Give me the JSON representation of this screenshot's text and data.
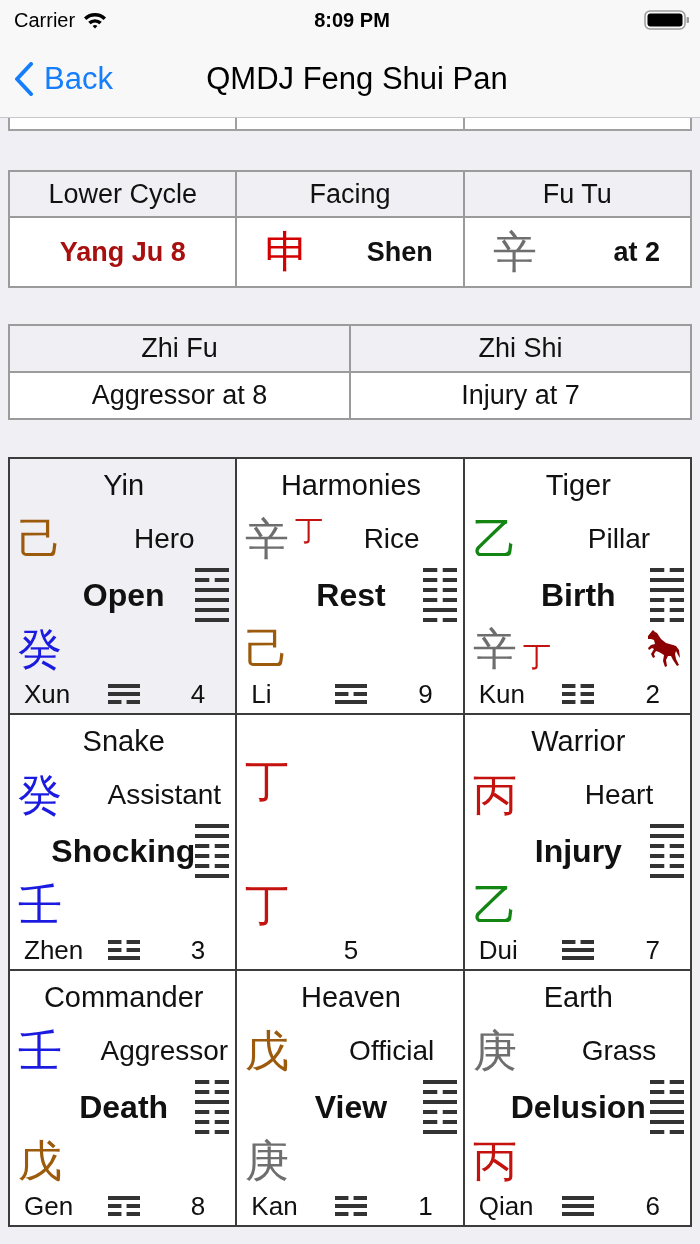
{
  "status_bar": {
    "carrier": "Carrier",
    "time": "8:09 PM"
  },
  "nav": {
    "back": "Back",
    "title": "QMDJ Feng Shui Pan"
  },
  "summary_table": {
    "columns": [
      "Lower Cycle",
      "Facing",
      "Fu Tu"
    ],
    "cells": [
      {
        "kind": "text",
        "text": "Yang Ju 8",
        "color": "#a81010"
      },
      {
        "kind": "stem",
        "stem": "申",
        "color": "#d40000",
        "text": "Shen"
      },
      {
        "kind": "stem",
        "stem": "辛",
        "color": "#6e6e6e",
        "text": "at 2"
      }
    ]
  },
  "zhi_table": {
    "columns": [
      "Zhi Fu",
      "Zhi Shi"
    ],
    "cells": [
      "Aggressor at 8",
      "Injury at 7"
    ]
  },
  "palace_rows": [
    {
      "palaces": [
        {
          "kind": "palace",
          "highlighted": true,
          "deity": "Yin",
          "upper_stems": [
            {
              "char": "己",
              "color": "#9c5b0c"
            }
          ],
          "star": "Hero",
          "door": "Open",
          "hexagram": [
            {
              "broken": false
            },
            {
              "broken": true
            },
            {
              "broken": false
            },
            {
              "broken": false
            },
            {
              "broken": false
            },
            {
              "broken": false
            }
          ],
          "lower_stems": [
            {
              "char": "癸",
              "color": "#1a1ae0"
            }
          ],
          "horse": false,
          "trigram_name": "Xun",
          "trigram": [
            {
              "broken": false
            },
            {
              "broken": false
            },
            {
              "broken": true
            }
          ],
          "number": "4"
        },
        {
          "kind": "palace",
          "highlighted": false,
          "deity": "Harmonies",
          "upper_stems": [
            {
              "char": "辛",
              "color": "#6e6e6e"
            },
            {
              "char": "丁",
              "color": "#c4130f"
            }
          ],
          "star": "Rice",
          "door": "Rest",
          "hexagram": [
            {
              "broken": true
            },
            {
              "broken": true
            },
            {
              "broken": true
            },
            {
              "broken": true
            },
            {
              "broken": false
            },
            {
              "broken": true
            }
          ],
          "lower_stems": [
            {
              "char": "己",
              "color": "#9c5b0c"
            }
          ],
          "horse": false,
          "trigram_name": "Li",
          "trigram": [
            {
              "broken": false
            },
            {
              "broken": true
            },
            {
              "broken": false
            }
          ],
          "number": "9"
        },
        {
          "kind": "palace",
          "highlighted": false,
          "deity": "Tiger",
          "upper_stems": [
            {
              "char": "乙",
              "color": "#138513"
            }
          ],
          "star": "Pillar",
          "door": "Birth",
          "hexagram": [
            {
              "broken": true
            },
            {
              "broken": false
            },
            {
              "broken": false
            },
            {
              "broken": true
            },
            {
              "broken": true
            },
            {
              "broken": true
            }
          ],
          "lower_stems": [
            {
              "char": "辛",
              "color": "#6e6e6e"
            },
            {
              "char": "丁",
              "color": "#c4130f"
            }
          ],
          "horse": true,
          "trigram_name": "Kun",
          "trigram": [
            {
              "broken": true
            },
            {
              "broken": true
            },
            {
              "broken": true
            }
          ],
          "number": "2"
        }
      ]
    },
    {
      "palaces": [
        {
          "kind": "palace",
          "highlighted": false,
          "deity": "Snake",
          "upper_stems": [
            {
              "char": "癸",
              "color": "#1a1ae0"
            }
          ],
          "star": "Assistant",
          "door": "Shocking",
          "hexagram": [
            {
              "broken": false
            },
            {
              "broken": false
            },
            {
              "broken": true
            },
            {
              "broken": true
            },
            {
              "broken": true
            },
            {
              "broken": false
            }
          ],
          "lower_stems": [
            {
              "char": "壬",
              "color": "#1a1ae0"
            }
          ],
          "horse": false,
          "trigram_name": "Zhen",
          "trigram": [
            {
              "broken": true
            },
            {
              "broken": true
            },
            {
              "broken": false
            }
          ],
          "number": "3"
        },
        {
          "kind": "center",
          "highlighted": false,
          "upper_stems": [
            {
              "char": "丁",
              "color": "#c4130f"
            }
          ],
          "lower_stems": [
            {
              "char": "丁",
              "color": "#c4130f"
            }
          ],
          "number": "5"
        },
        {
          "kind": "palace",
          "highlighted": false,
          "deity": "Warrior",
          "upper_stems": [
            {
              "char": "丙",
              "color": "#c4130f"
            }
          ],
          "star": "Heart",
          "door": "Injury",
          "hexagram": [
            {
              "broken": false
            },
            {
              "broken": false
            },
            {
              "broken": true
            },
            {
              "broken": true
            },
            {
              "broken": true
            },
            {
              "broken": false
            }
          ],
          "lower_stems": [
            {
              "char": "乙",
              "color": "#138513"
            }
          ],
          "horse": false,
          "trigram_name": "Dui",
          "trigram": [
            {
              "broken": true
            },
            {
              "broken": false
            },
            {
              "broken": false
            }
          ],
          "number": "7"
        }
      ]
    },
    {
      "palaces": [
        {
          "kind": "palace",
          "highlighted": false,
          "deity": "Commander",
          "upper_stems": [
            {
              "char": "壬",
              "color": "#1a1ae0"
            }
          ],
          "star": "Aggressor",
          "door": "Death",
          "hexagram": [
            {
              "broken": true
            },
            {
              "broken": true
            },
            {
              "broken": false
            },
            {
              "broken": true
            },
            {
              "broken": true
            },
            {
              "broken": true
            }
          ],
          "lower_stems": [
            {
              "char": "戊",
              "color": "#9c5b0c"
            }
          ],
          "horse": false,
          "trigram_name": "Gen",
          "trigram": [
            {
              "broken": false
            },
            {
              "broken": true
            },
            {
              "broken": true
            }
          ],
          "number": "8"
        },
        {
          "kind": "palace",
          "highlighted": false,
          "deity": "Heaven",
          "upper_stems": [
            {
              "char": "戊",
              "color": "#9c5b0c"
            }
          ],
          "star": "Official",
          "door": "View",
          "hexagram": [
            {
              "broken": false
            },
            {
              "broken": true
            },
            {
              "broken": false
            },
            {
              "broken": true
            },
            {
              "broken": true
            },
            {
              "broken": false
            }
          ],
          "lower_stems": [
            {
              "char": "庚",
              "color": "#6e6e6e"
            }
          ],
          "horse": false,
          "trigram_name": "Kan",
          "trigram": [
            {
              "broken": true
            },
            {
              "broken": false
            },
            {
              "broken": true
            }
          ],
          "number": "1"
        },
        {
          "kind": "palace",
          "highlighted": false,
          "deity": "Earth",
          "upper_stems": [
            {
              "char": "庚",
              "color": "#6e6e6e"
            }
          ],
          "star": "Grass",
          "door": "Delusion",
          "hexagram": [
            {
              "broken": true
            },
            {
              "broken": true
            },
            {
              "broken": false
            },
            {
              "broken": false
            },
            {
              "broken": false
            },
            {
              "broken": true
            }
          ],
          "lower_stems": [
            {
              "char": "丙",
              "color": "#c4130f"
            }
          ],
          "horse": false,
          "trigram_name": "Qian",
          "trigram": [
            {
              "broken": false
            },
            {
              "broken": false
            },
            {
              "broken": false
            }
          ],
          "number": "6"
        }
      ]
    }
  ]
}
